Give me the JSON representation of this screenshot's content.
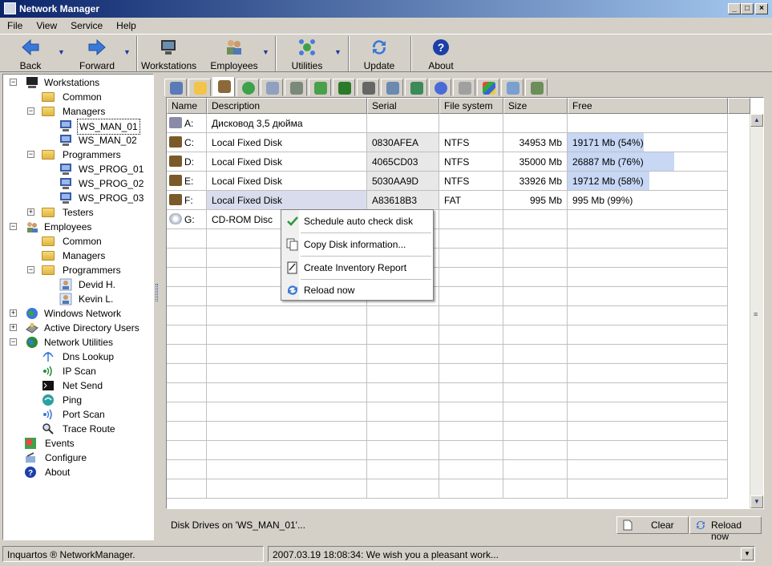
{
  "window": {
    "title": "Network Manager"
  },
  "menu": [
    "File",
    "View",
    "Service",
    "Help"
  ],
  "toolbar": {
    "back": "Back",
    "forward": "Forward",
    "workstations": "Workstations",
    "employees": "Employees",
    "utilities": "Utilities",
    "update": "Update",
    "about": "About"
  },
  "tree": {
    "workstations": "Workstations",
    "common": "Common",
    "managers": "Managers",
    "ws_man_01": "WS_MAN_01",
    "ws_man_02": "WS_MAN_02",
    "programmers": "Programmers",
    "ws_prog_01": "WS_PROG_01",
    "ws_prog_02": "WS_PROG_02",
    "ws_prog_03": "WS_PROG_03",
    "testers": "Testers",
    "employees": "Employees",
    "emp_common": "Common",
    "emp_managers": "Managers",
    "emp_programmers": "Programmers",
    "devid": "Devid H.",
    "kevin": "Kevin L.",
    "windows_network": "Windows Network",
    "active_directory": "Active Directory Users",
    "network_utilities": "Network Utilities",
    "dns": "Dns Lookup",
    "ipscan": "IP Scan",
    "netsend": "Net Send",
    "ping": "Ping",
    "portscan": "Port Scan",
    "traceroute": "Trace Route",
    "events": "Events",
    "configure": "Configure",
    "about": "About"
  },
  "grid": {
    "columns": [
      "Name",
      "Description",
      "Serial",
      "File system",
      "Size",
      "Free"
    ],
    "rows": [
      {
        "name": "A:",
        "desc": "Дисковод 3,5 дюйма",
        "serial": "",
        "fs": "",
        "size": "",
        "free": "",
        "fill": 0
      },
      {
        "name": "C:",
        "desc": "Local Fixed Disk",
        "serial": "0830AFEA",
        "fs": "NTFS",
        "size": "34953 Mb",
        "free": "19171 Mb  (54%)",
        "fill": 0.54
      },
      {
        "name": "D:",
        "desc": "Local Fixed Disk",
        "serial": "4065CD03",
        "fs": "NTFS",
        "size": "35000 Mb",
        "free": "26887 Mb  (76%)",
        "fill": 0.76
      },
      {
        "name": "E:",
        "desc": "Local Fixed Disk",
        "serial": "5030AA9D",
        "fs": "NTFS",
        "size": "33926 Mb",
        "free": "19712 Mb  (58%)",
        "fill": 0.58
      },
      {
        "name": "F:",
        "desc": "Local Fixed Disk",
        "serial": "A83618B3",
        "fs": "FAT",
        "size": "995 Mb",
        "free": "995 Mb  (99%)",
        "fill": 0
      },
      {
        "name": "G:",
        "desc": "CD-ROM Disc",
        "serial": "",
        "fs": "",
        "size": "",
        "free": "",
        "fill": 0
      }
    ]
  },
  "context_menu": [
    "Schedule auto check disk",
    "Copy Disk information...",
    "Create Inventory Report",
    "Reload now"
  ],
  "panel": {
    "caption": "Disk Drives on 'WS_MAN_01'...",
    "clear": "Clear",
    "reload": "Reload now"
  },
  "status": {
    "left": "Inquartos ® NetworkManager.",
    "message": "2007.03.19 18:08:34: We wish you a pleasant work..."
  }
}
